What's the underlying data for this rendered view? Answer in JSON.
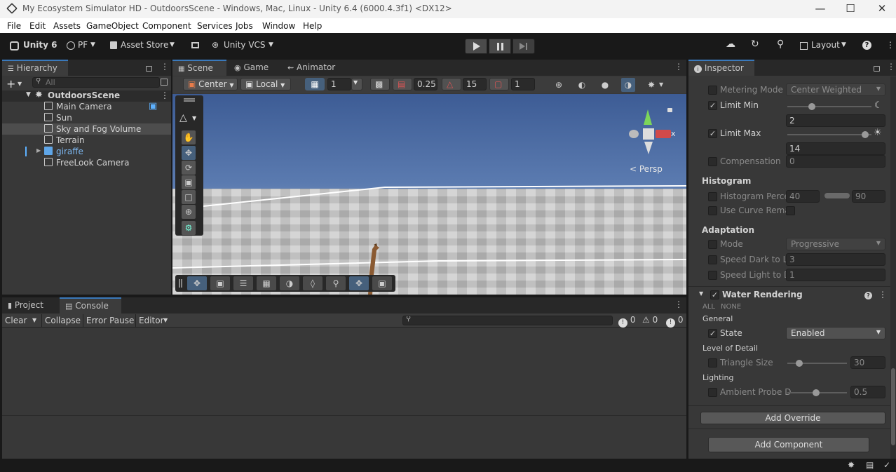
{
  "window": {
    "title": "My Ecosystem Simulator HD - OutdoorsScene - Windows, Mac, Linux - Unity 6.4 (6000.4.3f1) <DX12>"
  },
  "menu": [
    "File",
    "Edit",
    "Assets",
    "GameObject",
    "Component",
    "Services",
    "Jobs",
    "Window",
    "Help"
  ],
  "toolbar": {
    "unity_label": "Unity 6",
    "account": "PF",
    "asset_store": "Asset Store",
    "vcs": "Unity VCS",
    "layout": "Layout"
  },
  "hierarchy": {
    "tab": "Hierarchy",
    "search_placeholder": "All",
    "scene": "OutdoorsScene",
    "items": [
      "Main Camera",
      "Sun",
      "Sky and Fog Volume",
      "Terrain",
      "giraffe",
      "FreeLook Camera"
    ]
  },
  "scene_view": {
    "tabs": [
      "Scene",
      "Game",
      "Animator"
    ],
    "pivot": "Center",
    "space": "Local",
    "grid": "1",
    "snap_increment": "0.25",
    "rotation_snap": "15",
    "scale_snap": "1",
    "gizmo_axis": "x",
    "projection": "Persp"
  },
  "console": {
    "tabs": [
      "Project",
      "Console"
    ],
    "buttons": [
      "Clear",
      "Collapse",
      "Error Pause",
      "Editor"
    ],
    "counts": {
      "info": "0",
      "warn": "0",
      "error": "0"
    }
  },
  "inspector": {
    "tab": "Inspector",
    "metering_mode_label": "Metering Mode",
    "metering_mode_value": "Center Weighted",
    "limit_min_label": "Limit Min",
    "limit_min_value": "2",
    "limit_max_label": "Limit Max",
    "limit_max_value": "14",
    "compensation_label": "Compensation",
    "compensation_value": "0",
    "histogram_header": "Histogram",
    "histogram_percent_label": "Histogram Perce",
    "histogram_min": "40",
    "histogram_max": "90",
    "use_curve_label": "Use Curve Rema",
    "adaptation_header": "Adaptation",
    "mode_label": "Mode",
    "mode_value": "Progressive",
    "speed_dark_label": "Speed Dark to Li",
    "speed_dark_value": "3",
    "speed_light_label": "Speed Light to D",
    "speed_light_value": "1",
    "water_header": "Water Rendering",
    "all": "ALL",
    "none": "NONE",
    "general": "General",
    "state_label": "State",
    "state_value": "Enabled",
    "lod_header": "Level of Detail",
    "triangle_label": "Triangle Size",
    "triangle_value": "30",
    "lighting_header": "Lighting",
    "ambient_label": "Ambient Probe D",
    "ambient_value": "0.5",
    "add_override": "Add Override",
    "add_component": "Add Component"
  }
}
